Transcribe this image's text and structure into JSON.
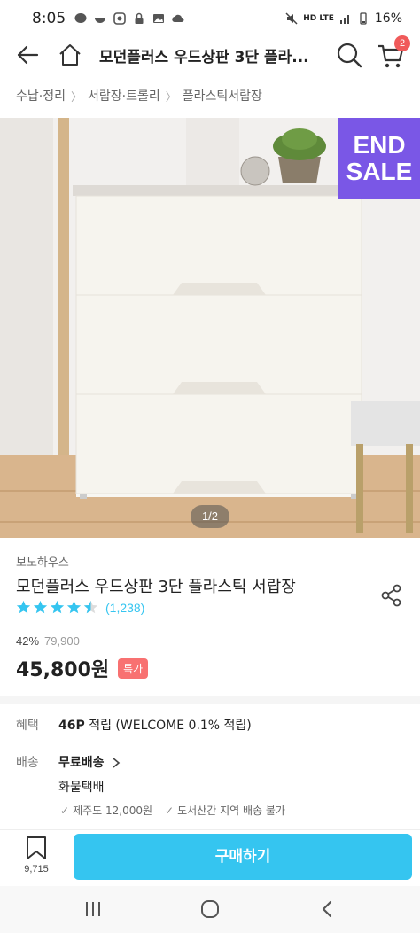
{
  "status": {
    "time": "8:05",
    "battery": "16%",
    "network": "HD LTE"
  },
  "header": {
    "title": "모던플러스 우드상판 3단 플라...",
    "cart_count": "2"
  },
  "breadcrumb": [
    "수납·정리",
    "서랍장·트롤리",
    "플라스틱서랍장"
  ],
  "hero": {
    "sale_tag_line1": "END",
    "sale_tag_line2": "SALE",
    "pager": "1/2"
  },
  "product": {
    "brand": "보노하우스",
    "name": "모던플러스 우드상판 3단 플라스틱 서랍장",
    "rating": 4.5,
    "review_count": "(1,238)",
    "discount": "42%",
    "original_price": "79,900",
    "price": "45,800원",
    "price_badge": "특가"
  },
  "benefit": {
    "label": "혜택",
    "points": "46P",
    "text": "적립 (WELCOME 0.1% 적립)"
  },
  "shipping": {
    "label": "배송",
    "method": "무료배송",
    "carrier": "화물택배",
    "note1": "제주도 12,000원",
    "note2": "도서산간 지역 배송 불가"
  },
  "bottom": {
    "bookmark_count": "9,715",
    "buy_label": "구매하기"
  },
  "colors": {
    "accent": "#35c5f0",
    "sale_badge": "#f87171",
    "end_sale_bg": "#7a57e6"
  }
}
